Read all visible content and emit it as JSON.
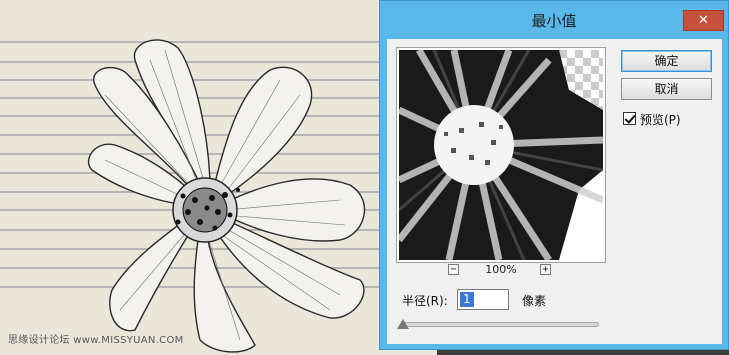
{
  "dialog": {
    "title": "最小值",
    "close_label": "✕",
    "ok_label": "确定",
    "cancel_label": "取消",
    "preview_label": "预览(P)",
    "preview_checked": true,
    "zoom_minus_label": "−",
    "zoom_plus_label": "+",
    "zoom_value": "100%",
    "radius_label": "半径(R):",
    "radius_value": "1",
    "radius_unit": "像素",
    "radius_slider_level": 0.0
  },
  "watermark": "思缘设计论坛 www.MISSYUAN.COM",
  "colors": {
    "title_bar": "#5ab7ea",
    "close_button": "#c74f3d",
    "dialog_body": "#f0f0f0",
    "canvas_paper": "#ece7dc",
    "paper_lines": "#b9b9b9",
    "selection": "#3a78d4"
  },
  "icons": {
    "close": "close-icon",
    "zoom_out": "minus-icon",
    "zoom_in": "plus-icon",
    "check": "checkmark-icon"
  }
}
